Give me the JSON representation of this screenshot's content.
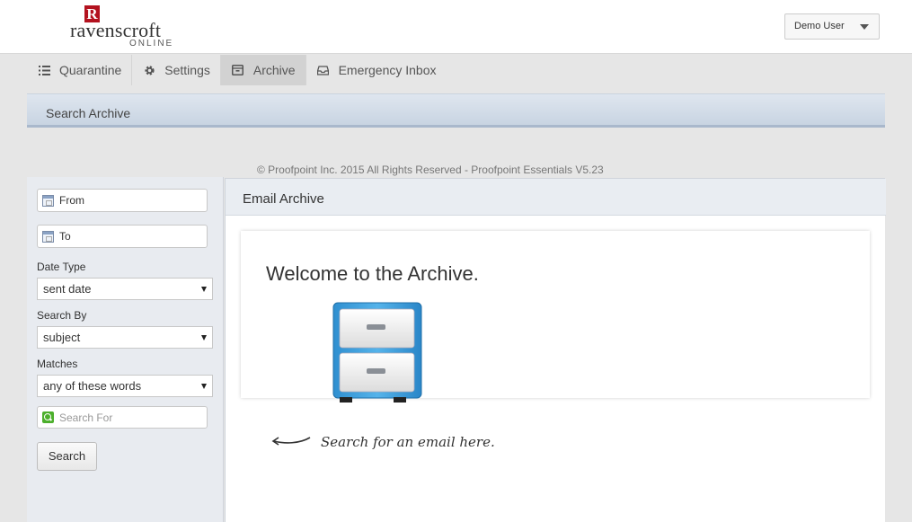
{
  "brand": {
    "mark": "R",
    "name": "ravenscroft",
    "sub": "ONLINE",
    "color": "#b3121f"
  },
  "user_menu": {
    "label": "Demo User"
  },
  "nav": {
    "items": [
      {
        "label": "Quarantine",
        "icon": "list-icon"
      },
      {
        "label": "Settings",
        "icon": "gear-icon"
      },
      {
        "label": "Archive",
        "icon": "archive-box-icon",
        "active": true
      },
      {
        "label": "Emergency Inbox",
        "icon": "inbox-icon"
      }
    ]
  },
  "band": {
    "title": "Search Archive"
  },
  "footer": {
    "copyright": "© Proofpoint Inc. 2015 All Rights Reserved - Proofpoint Essentials V5.23"
  },
  "sidebar": {
    "from_placeholder": "From",
    "to_placeholder": "To",
    "date_type": {
      "label": "Date Type",
      "value": "sent date"
    },
    "search_by": {
      "label": "Search By",
      "value": "subject"
    },
    "matches": {
      "label": "Matches",
      "value": "any of these words"
    },
    "search_placeholder": "Search For",
    "search_button": "Search"
  },
  "main": {
    "title": "Email Archive",
    "welcome": "Welcome to the Archive.",
    "hint": "Search for an email here."
  }
}
